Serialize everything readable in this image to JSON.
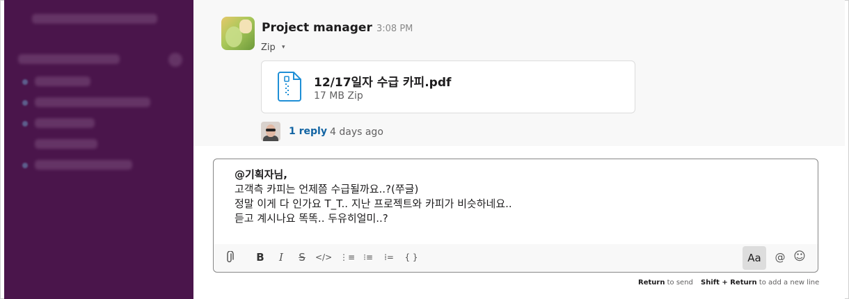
{
  "message": {
    "author": "Project manager",
    "time": "3:08 PM",
    "zip_label": "Zip",
    "zip_caret": "▾",
    "file": {
      "name": "12/17일자 수급 카피.pdf",
      "meta": "17 MB Zip"
    },
    "reply": {
      "count_label": "1 reply",
      "time": "4 days ago"
    }
  },
  "composer": {
    "lines": [
      "@기획자님,",
      "고객측 카피는 언제쯤 수급될까요..?(쭈글)",
      "정말 이게 다 인가요 T_T.. 지난 프로젝트와 카피가 비슷하네요..",
      "듣고 계시나요 똑똑.. 두유히얼미..?"
    ],
    "toolbar": {
      "attach": "⌀",
      "bold": "B",
      "italic": "I",
      "strike": "S",
      "code": "</>",
      "ordered_list": "⋮≡",
      "bullet_list": "⁝≡",
      "block_quote": "⁞=",
      "code_block": "{ }",
      "format_toggle": "Aa",
      "mention": "@",
      "emoji": "☺"
    }
  },
  "hints": {
    "send_key": "Return",
    "send_text": " to send",
    "newline_key": "Shift + Return",
    "newline_text": " to add a new line"
  },
  "colors": {
    "sidebar": "#4a154b",
    "link": "#1264a3"
  }
}
